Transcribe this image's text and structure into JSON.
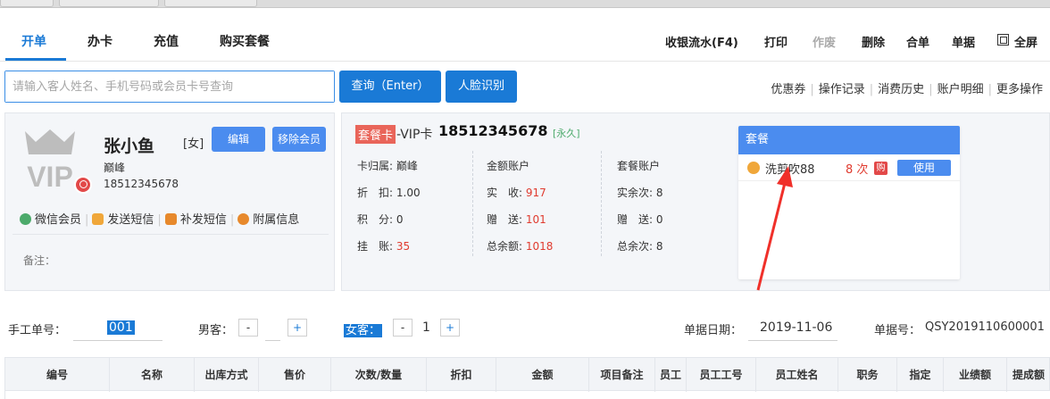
{
  "nav": {
    "tabs": [
      {
        "label": "开单"
      },
      {
        "label": "办卡"
      },
      {
        "label": "充值"
      },
      {
        "label": "购买套餐"
      }
    ],
    "actions": [
      {
        "label": "收银流水(F4)"
      },
      {
        "label": "打印"
      },
      {
        "label": "作废"
      },
      {
        "label": "删除"
      },
      {
        "label": "合单"
      },
      {
        "label": "单据"
      },
      {
        "label": "全屏"
      }
    ]
  },
  "search": {
    "placeholder": "请输入客人姓名、手机号码或会员卡号查询",
    "query_button": "查询（Enter）",
    "face_button": "人脸识别"
  },
  "links": [
    "优惠券",
    "操作记录",
    "消费历史",
    "账户明细",
    "更多操作"
  ],
  "customer": {
    "name": "张小鱼",
    "gender": "[女]",
    "stylist": "巅峰",
    "phone": "18512345678",
    "edit_button": "编辑",
    "remove_button": "移除会员",
    "actions": [
      "微信会员",
      "发送短信",
      "补发短信",
      "附属信息"
    ],
    "remark_label": "备注："
  },
  "card": {
    "type_tag": "套餐卡",
    "level": "-VIP卡",
    "number": "18512345678",
    "validity": "[永久]",
    "owner_label": "卡归属:",
    "owner": "巅峰",
    "discount_label": "折　扣:",
    "discount": "1.00",
    "points_label": "积　分:",
    "points": "0",
    "debt_label": "挂　账:",
    "debt": "35",
    "amount_title": "金额账户",
    "actual_label": "实　收:",
    "actual": "917",
    "gift_label": "赠　送:",
    "gift": "101",
    "total_label": "总余额:",
    "total": "1018",
    "pkg_title": "套餐账户",
    "real_times_label": "实余次:",
    "real_times": "8",
    "gift_times_label": "赠　送:",
    "gift_times": "0",
    "total_times_label": "总余次:",
    "total_times": "8"
  },
  "package": {
    "header": "套餐",
    "item_name": "洗剪吹88",
    "times": "8 次",
    "buy_tag": "购",
    "use_button": "使用"
  },
  "order_form": {
    "manual_no_label": "手工单号：",
    "manual_no": "001",
    "male_label": "男客：",
    "male_count": "",
    "female_label": "女客：",
    "female_count": "1",
    "minus": "-",
    "plus": "+",
    "date_label": "单据日期：",
    "date": "2019-11-06",
    "doc_no_label": "单据号：",
    "doc_no": "QSY2019110600001"
  },
  "table": {
    "headers": [
      "编号",
      "名称",
      "出库方式",
      "售价",
      "次数/数量",
      "折扣",
      "金额",
      "项目备注",
      "员工",
      "员工工号",
      "员工姓名",
      "职务",
      "指定",
      "业绩额",
      "提成额"
    ]
  },
  "colors": {
    "primary": "#1a7ad6",
    "button_blue": "#4b8cef",
    "danger": "#e03b2f",
    "panel_bg": "#f4f6f9"
  }
}
